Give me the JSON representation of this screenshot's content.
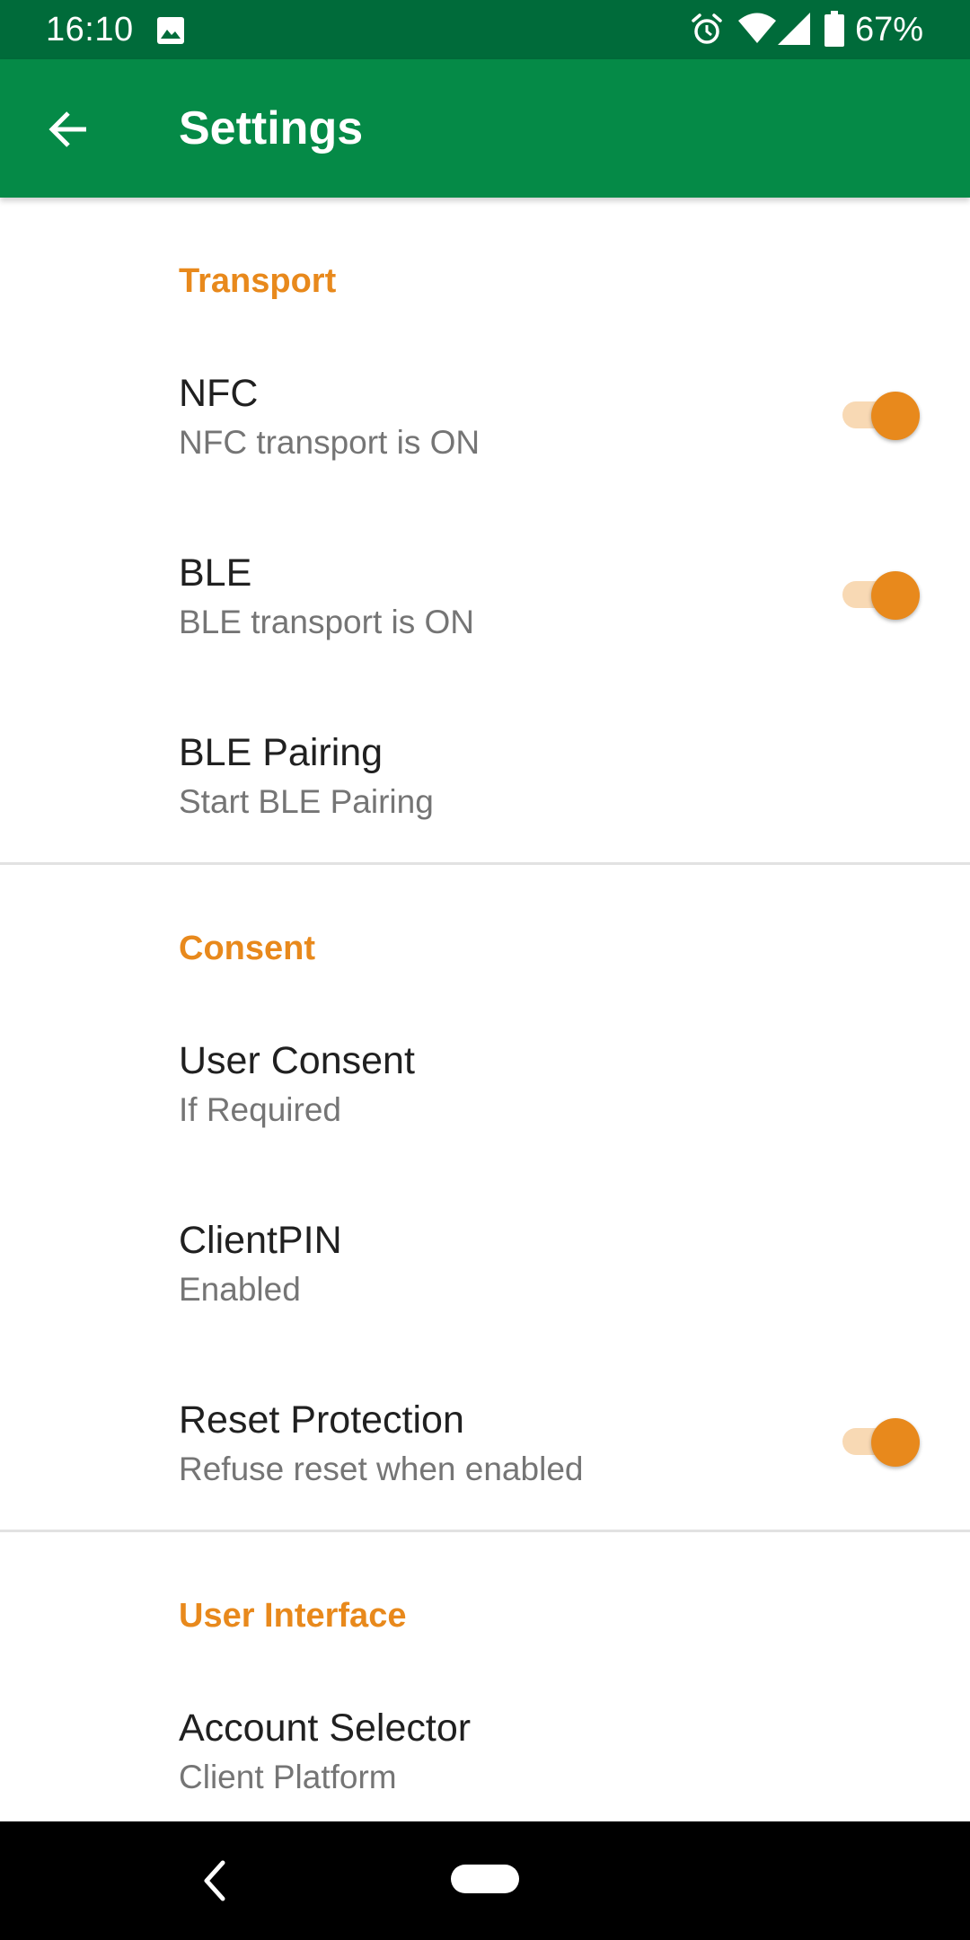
{
  "status_bar": {
    "time": "16:10",
    "battery": "67%",
    "icons": [
      "image-icon",
      "alarm-icon",
      "wifi-icon",
      "signal-icon",
      "battery-icon"
    ]
  },
  "app_bar": {
    "title": "Settings",
    "back_icon": "arrow-back-icon"
  },
  "colors": {
    "status_bar": "#006b3a",
    "app_bar": "#058a47",
    "accent": "#e8891c",
    "toggle_track": "#f8d9b4",
    "title_text": "#202020",
    "summary_text": "#757575"
  },
  "sections": {
    "transport": {
      "title": "Transport",
      "items": {
        "nfc": {
          "title": "NFC",
          "summary": "NFC transport is ON",
          "toggle_on": true
        },
        "ble": {
          "title": "BLE",
          "summary": "BLE transport is ON",
          "toggle_on": true
        },
        "ble_pairing": {
          "title": "BLE Pairing",
          "summary": "Start BLE Pairing"
        }
      }
    },
    "consent": {
      "title": "Consent",
      "items": {
        "user_consent": {
          "title": "User Consent",
          "summary": "If Required"
        },
        "client_pin": {
          "title": "ClientPIN",
          "summary": "Enabled"
        },
        "reset_protection": {
          "title": "Reset Protection",
          "summary": "Refuse reset when enabled",
          "toggle_on": true
        }
      }
    },
    "user_interface": {
      "title": "User Interface",
      "items": {
        "account_selector": {
          "title": "Account Selector",
          "summary": "Client Platform"
        }
      }
    }
  },
  "nav_bar": {
    "icons": [
      "nav-back-icon",
      "nav-home-pill"
    ]
  }
}
